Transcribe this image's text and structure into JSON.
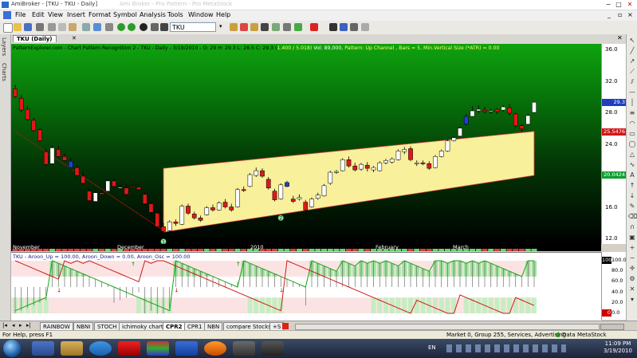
{
  "window": {
    "title": "AmiBroker - [TKU - TKU - Daily]",
    "blurred_title": "Ami Broker - Pro Pattern - Pro MetaStock"
  },
  "menu": [
    "File",
    "Edit",
    "View",
    "Insert",
    "Format",
    "Symbol",
    "Analysis",
    "Tools",
    "Window",
    "Help"
  ],
  "toolbar": {
    "symbol": "TKU"
  },
  "left_tabs": [
    "Layers",
    "Charts"
  ],
  "doc_tab": "TKU (Daily)",
  "price_pane": {
    "info_prefix": "PatternExplorer.com - Chart Pattern Recognition 2 - TKU - Daily - 3/19/2010 - O: 29 H: 29.3 L: 28.5 C: 29.3 (",
    "info_change": "1.400 /   5.018)",
    "info_vol": " Vol: 89,000, ",
    "info_pattern": "Pattern: Up Channel , Bars = 5, Min.Vertical Size (*ATR) = 0.00",
    "axis_ticks": [
      "36.0",
      "32.0",
      "28.0",
      "24.0",
      "20.0",
      "16.0",
      "12.0"
    ],
    "tags": [
      {
        "text": "29.3",
        "color": "#1f3fbf"
      },
      {
        "text": "25.5476",
        "color": "#d01818"
      },
      {
        "text": "20.0424",
        "color": "#0f9f2f"
      }
    ],
    "markers": [
      "1",
      "2"
    ]
  },
  "dates": [
    "November",
    "December",
    "2010",
    "February",
    "March"
  ],
  "indicator": {
    "info": "TKU - Aroon_Up = 100.00, Aroon_Down = 0.00, Aroon_Osc = 100.00",
    "axis_ticks": [
      "100.0",
      "80.0",
      "60.0",
      "40.0",
      "20.0",
      "0.0"
    ],
    "tag_top": "100",
    "tag_bottom": "0"
  },
  "sheets": [
    "RAINBOW",
    "NBNI",
    "STOCH",
    "ichimoky chart",
    "CPR2",
    "CPR1",
    "NBN",
    "compare Stocks",
    "+S"
  ],
  "active_sheet": "CPR2",
  "status": {
    "left": "For Help, press F1",
    "market": "Market 0, Group 255, Services, Advertising",
    "plugin": "Data MetaStock"
  },
  "taskbar": {
    "lang": "EN",
    "time": "11:09 PM",
    "date": "3/19/2010"
  },
  "colors": {
    "channel_fill": "#f8f09a",
    "channel_edge": "#d13a3a",
    "up_candle": "#ffffff",
    "down_candle": "#e01818",
    "blue_candle": "#1f3fd8",
    "aroon_up": "#1aa01a",
    "aroon_down": "#d01818"
  },
  "candles": [
    [
      31.0,
      31.5,
      29.8,
      30.0
    ],
    [
      29.8,
      30.2,
      28.0,
      28.3
    ],
    [
      28.4,
      28.8,
      26.9,
      27.1
    ],
    [
      27.0,
      27.3,
      25.5,
      25.7
    ],
    [
      25.8,
      26.0,
      24.2,
      24.4
    ],
    [
      23.0,
      23.4,
      21.2,
      21.4
    ],
    [
      21.5,
      23.8,
      21.3,
      23.5
    ],
    [
      23.3,
      23.7,
      22.2,
      22.4
    ],
    [
      22.4,
      22.8,
      21.7,
      21.9
    ],
    [
      21.8,
      22.2,
      20.8,
      21.0
    ],
    [
      21.0,
      21.3,
      19.8,
      20.0
    ],
    [
      19.9,
      20.4,
      18.8,
      19.0
    ],
    [
      18.0,
      18.4,
      16.6,
      16.8
    ],
    [
      16.7,
      18.0,
      16.5,
      17.8
    ],
    [
      17.8,
      18.2,
      17.5,
      17.6
    ],
    [
      18.0,
      19.5,
      17.9,
      19.3
    ],
    [
      19.3,
      19.6,
      18.4,
      18.6
    ],
    [
      18.5,
      18.9,
      18.3,
      18.5
    ],
    [
      18.4,
      18.8,
      17.4,
      17.6
    ],
    [
      18.6,
      19.0,
      18.3,
      18.5
    ],
    [
      18.5,
      18.9,
      18.1,
      18.2
    ],
    [
      17.6,
      17.9,
      16.2,
      16.4
    ],
    [
      16.4,
      16.7,
      15.1,
      15.3
    ],
    [
      15.2,
      15.5,
      13.3,
      13.5
    ],
    [
      13.5,
      14.0,
      12.6,
      12.9
    ],
    [
      13.0,
      14.3,
      12.9,
      14.1
    ],
    [
      14.1,
      14.4,
      13.6,
      13.9
    ],
    [
      13.8,
      16.3,
      13.7,
      16.1
    ],
    [
      16.1,
      16.4,
      15.0,
      15.2
    ],
    [
      15.1,
      15.4,
      14.4,
      14.6
    ],
    [
      14.6,
      14.9,
      14.1,
      14.3
    ],
    [
      15.0,
      16.1,
      14.9,
      15.9
    ],
    [
      15.9,
      16.3,
      15.4,
      15.6
    ],
    [
      15.6,
      16.7,
      15.5,
      16.5
    ],
    [
      16.6,
      17.0,
      15.8,
      16.0
    ],
    [
      16.0,
      16.4,
      15.4,
      15.6
    ],
    [
      16.0,
      18.4,
      15.9,
      18.2
    ],
    [
      18.2,
      18.6,
      17.9,
      18.1
    ],
    [
      18.6,
      20.3,
      18.5,
      20.1
    ],
    [
      20.0,
      21.0,
      19.8,
      20.6
    ],
    [
      20.6,
      20.9,
      19.7,
      19.9
    ],
    [
      19.5,
      19.8,
      18.2,
      18.4
    ],
    [
      18.0,
      18.3,
      16.7,
      16.9
    ],
    [
      17.0,
      19.0,
      16.9,
      18.8
    ],
    [
      18.6,
      19.3,
      18.5,
      19.1
    ],
    [
      17.0,
      17.4,
      16.5,
      16.7
    ],
    [
      17.0,
      17.6,
      16.8,
      17.2
    ],
    [
      16.6,
      16.9,
      15.4,
      15.6
    ],
    [
      16.0,
      17.2,
      15.9,
      17.0
    ],
    [
      17.1,
      17.8,
      16.9,
      17.5
    ],
    [
      17.4,
      18.9,
      17.3,
      18.7
    ],
    [
      19.0,
      20.6,
      18.8,
      20.4
    ],
    [
      20.4,
      20.7,
      20.2,
      20.5
    ],
    [
      20.6,
      22.2,
      20.5,
      22.0
    ],
    [
      22.0,
      22.4,
      21.0,
      21.2
    ],
    [
      21.2,
      21.6,
      20.5,
      20.7
    ],
    [
      20.8,
      21.6,
      20.6,
      21.4
    ],
    [
      21.3,
      21.7,
      20.5,
      20.9
    ],
    [
      20.7,
      21.2,
      20.4,
      21.0
    ],
    [
      20.6,
      21.8,
      20.5,
      21.6
    ],
    [
      21.6,
      22.1,
      21.4,
      21.9
    ],
    [
      21.7,
      22.3,
      21.5,
      22.1
    ],
    [
      22.0,
      23.3,
      21.9,
      23.1
    ],
    [
      23.0,
      23.6,
      22.7,
      23.3
    ],
    [
      23.4,
      23.7,
      21.8,
      22.0
    ],
    [
      21.5,
      21.9,
      21.2,
      21.6
    ],
    [
      21.6,
      21.9,
      21.3,
      21.5
    ],
    [
      21.5,
      21.8,
      20.7,
      20.9
    ],
    [
      21.0,
      22.6,
      20.9,
      22.4
    ],
    [
      22.4,
      23.3,
      22.3,
      23.1
    ],
    [
      23.1,
      24.6,
      23.0,
      24.4
    ],
    [
      24.4,
      25.0,
      24.3,
      24.8
    ],
    [
      25.0,
      26.2,
      24.9,
      26.0
    ],
    [
      26.5,
      27.8,
      26.3,
      27.5
    ],
    [
      27.5,
      28.8,
      27.4,
      28.2
    ],
    [
      28.2,
      28.9,
      27.9,
      28.4
    ],
    [
      28.3,
      28.7,
      27.9,
      28.1
    ],
    [
      28.1,
      28.5,
      27.8,
      28.2
    ],
    [
      28.4,
      28.6,
      27.8,
      28.1
    ],
    [
      28.3,
      28.9,
      28.1,
      28.7
    ],
    [
      28.6,
      29.1,
      27.6,
      27.9
    ],
    [
      27.8,
      28.0,
      26.0,
      26.3
    ],
    [
      26.3,
      26.6,
      25.6,
      25.9
    ],
    [
      26.5,
      27.8,
      26.4,
      27.6
    ],
    [
      28.0,
      29.4,
      27.9,
      29.3
    ]
  ],
  "blue_candles": [
    9,
    44,
    73,
    85
  ],
  "aroon_up": [
    5,
    10,
    15,
    20,
    25,
    30,
    100,
    95,
    90,
    85,
    80,
    75,
    70,
    65,
    60,
    55,
    50,
    45,
    40,
    35,
    30,
    25,
    20,
    15,
    10,
    5,
    100,
    95,
    90,
    85,
    80,
    75,
    70,
    65,
    60,
    55,
    50,
    100,
    95,
    90,
    85,
    80,
    75,
    70,
    65,
    60,
    55,
    50,
    100,
    95,
    90,
    85,
    80,
    100,
    95,
    90,
    100,
    95,
    100,
    95,
    100,
    95,
    90,
    100,
    95,
    90,
    85,
    80,
    100,
    100,
    95,
    100,
    100,
    95,
    100,
    95,
    100,
    95,
    90,
    85,
    80,
    75,
    70,
    100,
    100
  ],
  "aroon_down": [
    100,
    95,
    90,
    85,
    80,
    75,
    70,
    65,
    100,
    95,
    100,
    95,
    100,
    95,
    90,
    85,
    80,
    75,
    70,
    65,
    60,
    100,
    95,
    100,
    100,
    95,
    90,
    85,
    80,
    75,
    70,
    65,
    60,
    55,
    50,
    45,
    40,
    35,
    30,
    25,
    20,
    15,
    10,
    5,
    100,
    95,
    90,
    85,
    80,
    75,
    70,
    65,
    60,
    55,
    50,
    45,
    40,
    35,
    30,
    25,
    20,
    15,
    10,
    5,
    0,
    25,
    20,
    15,
    10,
    5,
    0,
    0,
    35,
    30,
    25,
    20,
    15,
    10,
    5,
    0,
    0,
    30,
    25,
    20,
    15
  ]
}
